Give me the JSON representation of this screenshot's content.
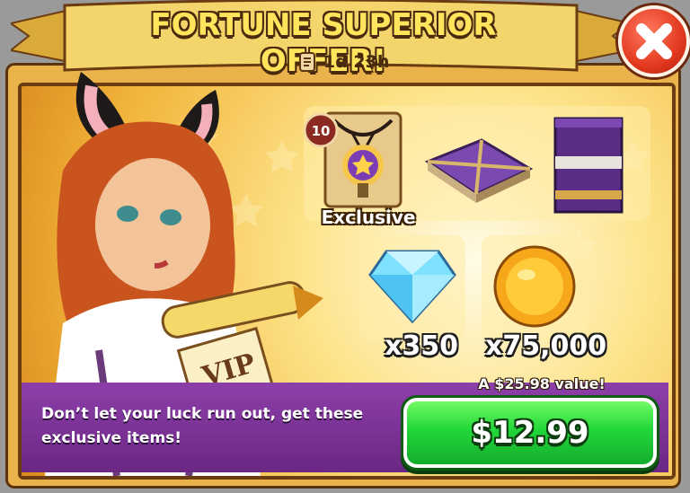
{
  "offer": {
    "title": "FORTUNE SUPERIOR OFFER!",
    "timer": "1d 23h"
  },
  "rewards": {
    "exclusive_badge_count": "10",
    "exclusive_label": "Exclusive",
    "gems_quantity": "x350",
    "gold_quantity": "x75,000",
    "value_text": "A $25.98 value!"
  },
  "character": {
    "scroll_text": "VIP"
  },
  "footer": {
    "description": "Don’t let your luck run out, get these exclusive items!",
    "buy_label": "$12.99"
  },
  "colors": {
    "title": "#ffe45c",
    "buy_button": "#22d83a",
    "close_button": "#e2391f",
    "strip": "#7a2f97"
  },
  "icons": [
    "scroll-timer-icon",
    "close-icon",
    "amulet-icon",
    "book-closed-icon",
    "book-open-icon",
    "gem-icon",
    "gold-coin-icon"
  ]
}
